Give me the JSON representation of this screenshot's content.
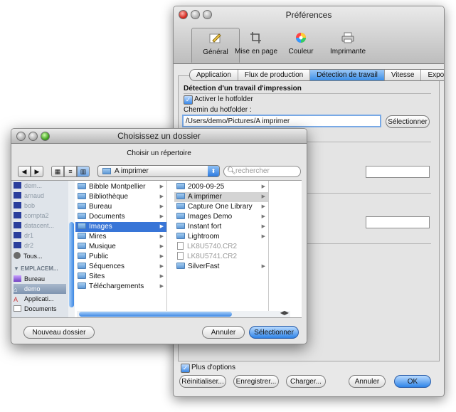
{
  "prefs": {
    "title": "Préférences",
    "toolbar": [
      "Général",
      "Mise en page",
      "Couleur",
      "Imprimante"
    ],
    "tabs": [
      "Application",
      "Flux de production",
      "Détection de travail",
      "Vitesse",
      "Exportation"
    ],
    "section_title": "Détection d'un travail d'impression",
    "activate_label": "Activer le hotfolder",
    "path_label": "Chemin du hotfolder :",
    "path_value": "/Users/demo/Pictures/A imprimer",
    "select_button": "Sélectionner",
    "more_options": "Plus d'options",
    "buttons": {
      "reset": "Réinitialiser...",
      "save": "Enregistrer...",
      "load": "Charger...",
      "cancel": "Annuler",
      "ok": "OK"
    }
  },
  "dialog": {
    "title": "Choisissez un dossier",
    "subtitle": "Choisir un répertoire",
    "location": "A imprimer",
    "search_placeholder": "rechercher",
    "sidebar": {
      "more": "Tous...",
      "places_header": "EMPLACEM...",
      "places": [
        "Bureau",
        "demo",
        "Applicati...",
        "Documents"
      ]
    },
    "col1": [
      "Bibble Montpellier",
      "Bibliothèque",
      "Bureau",
      "Documents",
      "Images",
      "Mires",
      "Musique",
      "Public",
      "Séquences",
      "Sites",
      "Téléchargements"
    ],
    "col2": [
      "2009-09-25",
      "A imprimer",
      "Capture One Library",
      "Images Demo",
      "Instant fort",
      "Lightroom",
      "LK8U5740.CR2",
      "LK8U5741.CR2",
      "SilverFast"
    ],
    "new_folder": "Nouveau dossier",
    "cancel": "Annuler",
    "select": "Sélectionner"
  },
  "colors": {
    "accent": "#3875d7",
    "window_bg": "#e6e6e6"
  }
}
